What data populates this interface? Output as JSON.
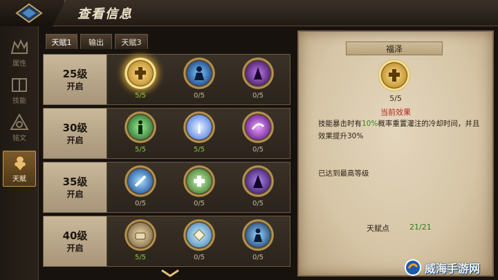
{
  "header": {
    "title": "查看信息"
  },
  "sidebar": {
    "items": [
      {
        "label": "属性",
        "icon": "attributes-icon",
        "active": false
      },
      {
        "label": "技能",
        "icon": "skills-book-icon",
        "active": false
      },
      {
        "label": "铭文",
        "icon": "inscription-icon",
        "active": false
      },
      {
        "label": "天赋",
        "icon": "talent-icon",
        "active": true
      }
    ]
  },
  "tabs": [
    {
      "label": "天赋1",
      "active": true
    },
    {
      "label": "输出",
      "active": false
    },
    {
      "label": "天赋3",
      "active": false
    }
  ],
  "rows": [
    {
      "level": "25级",
      "open": "开启",
      "talents": [
        {
          "icon": "gold-cross-icon",
          "count": "5/5",
          "full": true,
          "selected": true
        },
        {
          "icon": "blue-figure-icon",
          "count": "0/5",
          "full": false
        },
        {
          "icon": "purple-mage-icon",
          "count": "0/5",
          "full": false
        }
      ]
    },
    {
      "level": "30级",
      "open": "开启",
      "talents": [
        {
          "icon": "green-warrior-icon",
          "count": "5/5",
          "full": true
        },
        {
          "icon": "blue-light-burst-icon",
          "count": "5/5",
          "full": true
        },
        {
          "icon": "purple-swirl-icon",
          "count": "0/5",
          "full": false
        }
      ]
    },
    {
      "level": "35级",
      "open": "开启",
      "talents": [
        {
          "icon": "blue-strike-icon",
          "count": "0/5",
          "full": false
        },
        {
          "icon": "green-heal-cross-icon",
          "count": "0/5",
          "full": false
        },
        {
          "icon": "purple-robe-icon",
          "count": "0/5",
          "full": false
        }
      ]
    },
    {
      "level": "40级",
      "open": "开启",
      "talents": [
        {
          "icon": "hand-scroll-icon",
          "count": "5/5",
          "full": true
        },
        {
          "icon": "rune-tablet-icon",
          "count": "0/5",
          "full": false
        },
        {
          "icon": "blue-figure-aura-icon",
          "count": "0/5",
          "full": false
        }
      ]
    }
  ],
  "detail": {
    "name": "福泽",
    "icon": "gold-cross-icon",
    "count": "5/5",
    "effect_title": "当前效果",
    "desc_before": "技能暴击时有",
    "desc_highlight": "10%",
    "desc_after": "概率重置灌注的冷却时间，并且效果提升30%",
    "max_text": "已达到最高等级",
    "points_label": "天赋点",
    "points_value": "21/21"
  },
  "watermark": {
    "text": "威海手游网"
  },
  "colors": {
    "accent_gold": "#f5d36a",
    "full_green": "#8ecc3c",
    "effect_red": "#b2261c"
  }
}
